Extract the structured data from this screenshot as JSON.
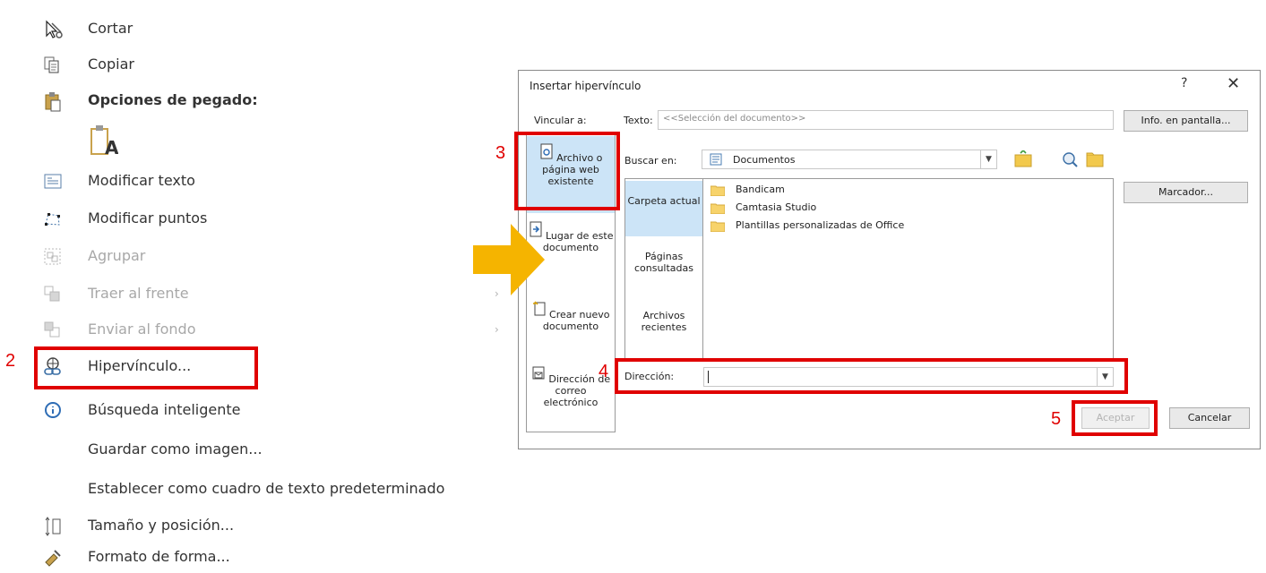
{
  "context_menu": {
    "items": [
      {
        "label": "Cortar",
        "icon": "scissors-icon",
        "disabled": false
      },
      {
        "label": "Copiar",
        "icon": "copy-icon",
        "disabled": false
      },
      {
        "label": "Opciones de pegado:",
        "icon": "paste-icon",
        "disabled": false,
        "bold": true
      },
      {
        "label": "",
        "icon": "paste-text-only-icon",
        "disabled": false
      },
      {
        "label": "Modificar texto",
        "icon": "edit-text-icon",
        "disabled": false
      },
      {
        "label": "Modificar puntos",
        "icon": "edit-points-icon",
        "disabled": false
      },
      {
        "label": "Agrupar",
        "icon": "group-icon",
        "disabled": true
      },
      {
        "label": "Traer al frente",
        "icon": "bring-front-icon",
        "disabled": true
      },
      {
        "label": "Enviar al fondo",
        "icon": "send-back-icon",
        "disabled": true
      },
      {
        "label": "Hipervínculo...",
        "icon": "hyperlink-icon",
        "disabled": false
      },
      {
        "label": "Búsqueda inteligente",
        "icon": "smart-lookup-icon",
        "disabled": false
      },
      {
        "label": "Guardar como imagen...",
        "icon": "",
        "disabled": false
      },
      {
        "label": "Establecer como cuadro de texto predeterminado",
        "icon": "",
        "disabled": false
      },
      {
        "label": "Tamaño y posición...",
        "icon": "size-position-icon",
        "disabled": false
      },
      {
        "label": "Formato de forma...",
        "icon": "format-shape-icon",
        "disabled": false
      }
    ]
  },
  "dialog": {
    "title": "Insertar hipervínculo",
    "help": "?",
    "close": "✕",
    "vincular_label": "Vincular a:",
    "texto_label": "Texto:",
    "texto_value": "<<Selección del documento>>",
    "info_button": "Info. en pantalla...",
    "link_types": [
      {
        "label": "Archivo o página web existente",
        "selected": true
      },
      {
        "label": "Lugar de este documento",
        "selected": false
      },
      {
        "label": "Crear nuevo documento",
        "selected": false
      },
      {
        "label": "Dirección de correo electrónico",
        "selected": false
      }
    ],
    "buscar_label": "Buscar en:",
    "buscar_value": "Documentos",
    "sub_nav": [
      {
        "label": "Carpeta actual",
        "selected": true
      },
      {
        "label": "Páginas consultadas",
        "selected": false
      },
      {
        "label": "Archivos recientes",
        "selected": false
      }
    ],
    "files": [
      "Bandicam",
      "Camtasia Studio",
      "Plantillas personalizadas de Office"
    ],
    "marcador_button": "Marcador...",
    "direccion_label": "Dirección:",
    "direccion_value": "",
    "aceptar_button": "Aceptar",
    "cancelar_button": "Cancelar"
  },
  "annotations": {
    "steps": [
      "2",
      "3",
      "4",
      "5"
    ],
    "highlight_color": "#e00000",
    "arrow_color": "#f5b400"
  }
}
